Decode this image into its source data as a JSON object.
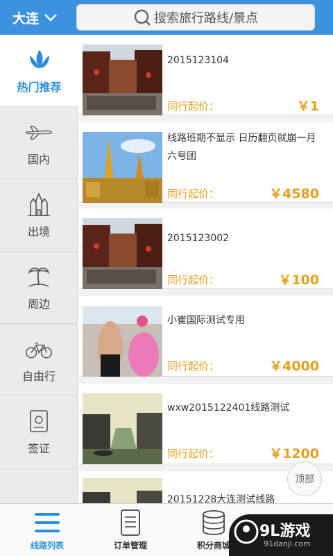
{
  "header": {
    "city": "大连",
    "search_placeholder": "搜索旅行路线/景点"
  },
  "sidebar": {
    "items": [
      {
        "label": "热门推荐",
        "icon": "lotus-icon",
        "active": true
      },
      {
        "label": "国内",
        "icon": "airplane-icon",
        "active": false
      },
      {
        "label": "出境",
        "icon": "castle-icon",
        "active": false
      },
      {
        "label": "周边",
        "icon": "palm-tree-icon",
        "active": false
      },
      {
        "label": "自由行",
        "icon": "bicycle-icon",
        "active": false
      },
      {
        "label": "签证",
        "icon": "passport-icon",
        "active": false
      }
    ]
  },
  "routes": {
    "price_label": "同行起价：",
    "items": [
      {
        "title": "2015123104",
        "price": "￥1",
        "image": "ancient-street-photo"
      },
      {
        "title": " 线路班期不显示 日历翻页就崩一月六号团",
        "price": "￥4580",
        "image": "golden-pagoda-photo"
      },
      {
        "title": "2015123002",
        "price": "￥100",
        "image": "ancient-street-photo"
      },
      {
        "title": "小崔国际测试专用",
        "price": "￥4000",
        "image": "carnival-dancers-photo"
      },
      {
        "title": "wxw2015122401线路测试",
        "price": "￥1200",
        "image": "water-town-photo"
      },
      {
        "title": "20151228大连测试线路",
        "price": "",
        "image": "water-town-photo"
      }
    ]
  },
  "back_to_top": "顶部",
  "tabbar": {
    "items": [
      {
        "label": "线路列表",
        "icon": "list-icon",
        "active": true
      },
      {
        "label": "订单管理",
        "icon": "document-icon",
        "active": false
      },
      {
        "label": "积分商城",
        "icon": "coin-stack-icon",
        "active": false
      },
      {
        "label": "",
        "icon": "user-icon",
        "active": false
      }
    ]
  },
  "watermark": {
    "brand": "9L游戏",
    "url": "91danji.com"
  },
  "colors": {
    "header_blue": "#3d92e0",
    "accent_blue": "#2b8ed9",
    "price_orange": "#e6a020"
  }
}
